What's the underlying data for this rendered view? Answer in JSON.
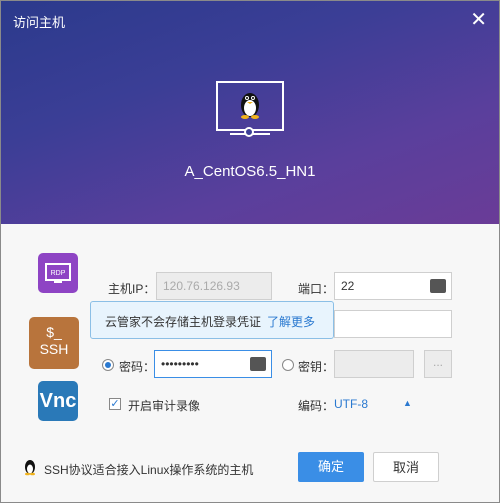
{
  "window": {
    "title": "访问主机",
    "close_glyph": "✕"
  },
  "host": {
    "name": "A_CentOS6.5_HN1"
  },
  "protocols": [
    {
      "label": "RDP",
      "icon": "rdp-icon",
      "color": "#8e44c4"
    },
    {
      "label_line1": "$_",
      "label_line2": "SSH",
      "icon": "ssh-icon",
      "color": "#b8743c"
    },
    {
      "label": "Vnc",
      "icon": "vnc-icon",
      "color": "#2a79b8"
    }
  ],
  "form": {
    "host_ip_label": "主机IP：",
    "host_ip_value": "120.76.126.93",
    "port_label": "端口：",
    "port_value": "22",
    "password_label": "密码：",
    "password_value": "•••••••••",
    "key_label": "密钥：",
    "key_browse": "...",
    "record_label": "开启审计录像",
    "encoding_label": "编码：",
    "encoding_value": "UTF-8",
    "encoding_arrow": "▲"
  },
  "tooltip": {
    "text": "云管家不会存储主机登录凭证",
    "link": "了解更多"
  },
  "footer": {
    "note": "SSH协议适合接入Linux操作系统的主机"
  },
  "buttons": {
    "ok": "确定",
    "cancel": "取消"
  },
  "accent_color": "#3a8ee6"
}
